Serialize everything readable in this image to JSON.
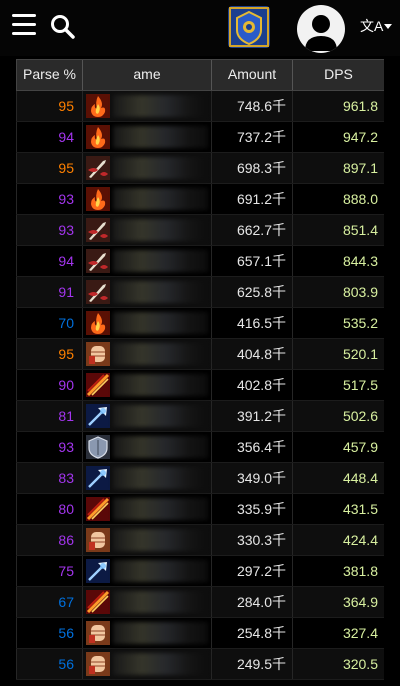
{
  "header": {
    "menu_icon": "hamburger-menu-icon",
    "search_icon": "search-icon",
    "logo_icon": "guild-crest-logo",
    "avatar_icon": "user-avatar-icon",
    "language_glyph": "文A"
  },
  "table": {
    "columns": {
      "parse": "Parse %",
      "name": "ame",
      "amount": "Amount",
      "dps": "DPS"
    },
    "rows": [
      {
        "parse": "95",
        "amount": "748.6千",
        "dps": "961.8",
        "color": "#ff8000",
        "spec": "fire"
      },
      {
        "parse": "94",
        "amount": "737.2千",
        "dps": "947.2",
        "color": "#a335ee",
        "spec": "fire"
      },
      {
        "parse": "95",
        "amount": "698.3千",
        "dps": "897.1",
        "color": "#ff8000",
        "spec": "ret"
      },
      {
        "parse": "93",
        "amount": "691.2千",
        "dps": "888.0",
        "color": "#a335ee",
        "spec": "fire"
      },
      {
        "parse": "93",
        "amount": "662.7千",
        "dps": "851.4",
        "color": "#a335ee",
        "spec": "ret"
      },
      {
        "parse": "94",
        "amount": "657.1千",
        "dps": "844.3",
        "color": "#a335ee",
        "spec": "ret"
      },
      {
        "parse": "91",
        "amount": "625.8千",
        "dps": "803.9",
        "color": "#a335ee",
        "spec": "ret"
      },
      {
        "parse": "70",
        "amount": "416.5千",
        "dps": "535.2",
        "color": "#0070dd",
        "spec": "fire"
      },
      {
        "parse": "95",
        "amount": "404.8千",
        "dps": "520.1",
        "color": "#ff8000",
        "spec": "fist"
      },
      {
        "parse": "90",
        "amount": "402.8千",
        "dps": "517.5",
        "color": "#a335ee",
        "spec": "slash"
      },
      {
        "parse": "81",
        "amount": "391.2千",
        "dps": "502.6",
        "color": "#a335ee",
        "spec": "frost"
      },
      {
        "parse": "93",
        "amount": "356.4千",
        "dps": "457.9",
        "color": "#a335ee",
        "spec": "shield"
      },
      {
        "parse": "83",
        "amount": "349.0千",
        "dps": "448.4",
        "color": "#a335ee",
        "spec": "frost"
      },
      {
        "parse": "80",
        "amount": "335.9千",
        "dps": "431.5",
        "color": "#a335ee",
        "spec": "slash"
      },
      {
        "parse": "86",
        "amount": "330.3千",
        "dps": "424.4",
        "color": "#a335ee",
        "spec": "fist"
      },
      {
        "parse": "75",
        "amount": "297.2千",
        "dps": "381.8",
        "color": "#a335ee",
        "spec": "frost"
      },
      {
        "parse": "67",
        "amount": "284.0千",
        "dps": "364.9",
        "color": "#0070dd",
        "spec": "slash"
      },
      {
        "parse": "56",
        "amount": "254.8千",
        "dps": "327.4",
        "color": "#0070dd",
        "spec": "fist"
      },
      {
        "parse": "56",
        "amount": "249.5千",
        "dps": "320.5",
        "color": "#0070dd",
        "spec": "fist"
      }
    ]
  }
}
